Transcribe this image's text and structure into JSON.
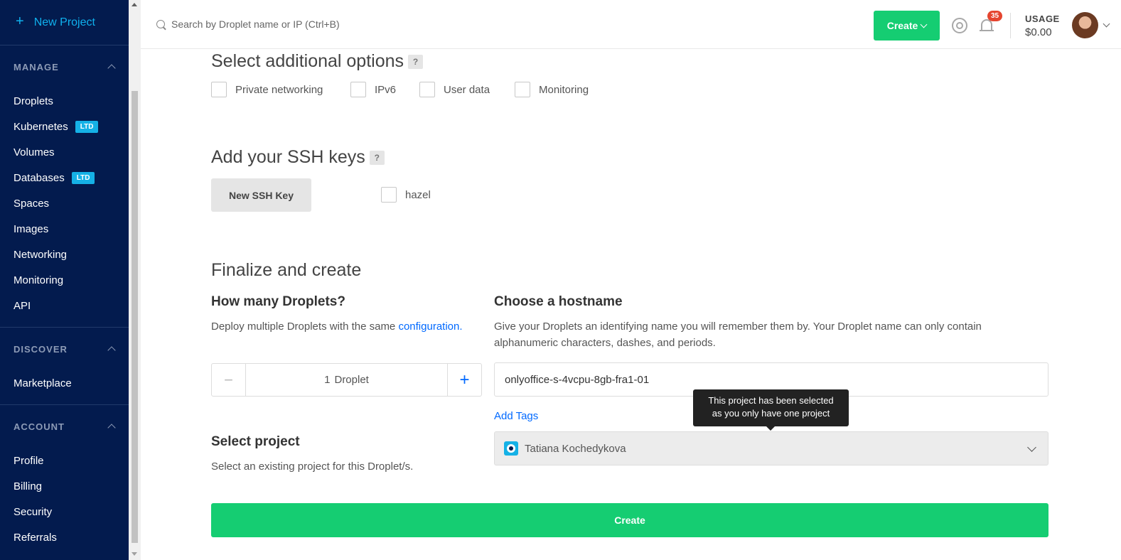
{
  "sidebar": {
    "new_project": "New Project",
    "groups": [
      {
        "title": "MANAGE",
        "items": [
          {
            "label": "Droplets"
          },
          {
            "label": "Kubernetes",
            "badge": "LTD"
          },
          {
            "label": "Volumes"
          },
          {
            "label": "Databases",
            "badge": "LTD"
          },
          {
            "label": "Spaces"
          },
          {
            "label": "Images"
          },
          {
            "label": "Networking"
          },
          {
            "label": "Monitoring"
          },
          {
            "label": "API"
          }
        ]
      },
      {
        "title": "DISCOVER",
        "items": [
          {
            "label": "Marketplace"
          }
        ]
      },
      {
        "title": "ACCOUNT",
        "items": [
          {
            "label": "Profile"
          },
          {
            "label": "Billing"
          },
          {
            "label": "Security"
          },
          {
            "label": "Referrals"
          }
        ]
      }
    ]
  },
  "topbar": {
    "search_placeholder": "Search by Droplet name or IP (Ctrl+B)",
    "create_label": "Create",
    "notifications_count": "35",
    "usage_label": "USAGE",
    "usage_value": "$0.00"
  },
  "options": {
    "title": "Select additional options",
    "help": "?",
    "checkboxes": [
      "Private networking",
      "IPv6",
      "User data",
      "Monitoring"
    ]
  },
  "ssh": {
    "title": "Add your SSH keys",
    "help": "?",
    "new_key_label": "New SSH Key",
    "keys": [
      "hazel"
    ]
  },
  "finalize": {
    "title": "Finalize and create",
    "count_title": "How many Droplets?",
    "count_desc": "Deploy multiple Droplets with the same ",
    "count_desc_link": "configuration.",
    "count_value": "1",
    "count_unit": "Droplet",
    "hostname_title": "Choose a hostname",
    "hostname_desc_1": "Give your Droplets an identifying name you will remember them by. Your Droplet name can only contain",
    "hostname_desc_2": "alphanumeric characters, dashes, and periods.",
    "hostname_value": "onlyoffice-s-4vcpu-8gb-fra1-01",
    "add_tags": "Add Tags",
    "tooltip_1": "This project has been selected",
    "tooltip_2": "as you only have one project",
    "project_title": "Select project",
    "project_desc": "Select an existing project for this Droplet/s.",
    "project_value": "Tatiana Kochedykova",
    "create_label": "Create"
  },
  "colors": {
    "sidebar_bg": "#031b4e",
    "accent_green": "#15cd72",
    "link_blue": "#0069ff",
    "badge_blue": "#15b1e6"
  }
}
